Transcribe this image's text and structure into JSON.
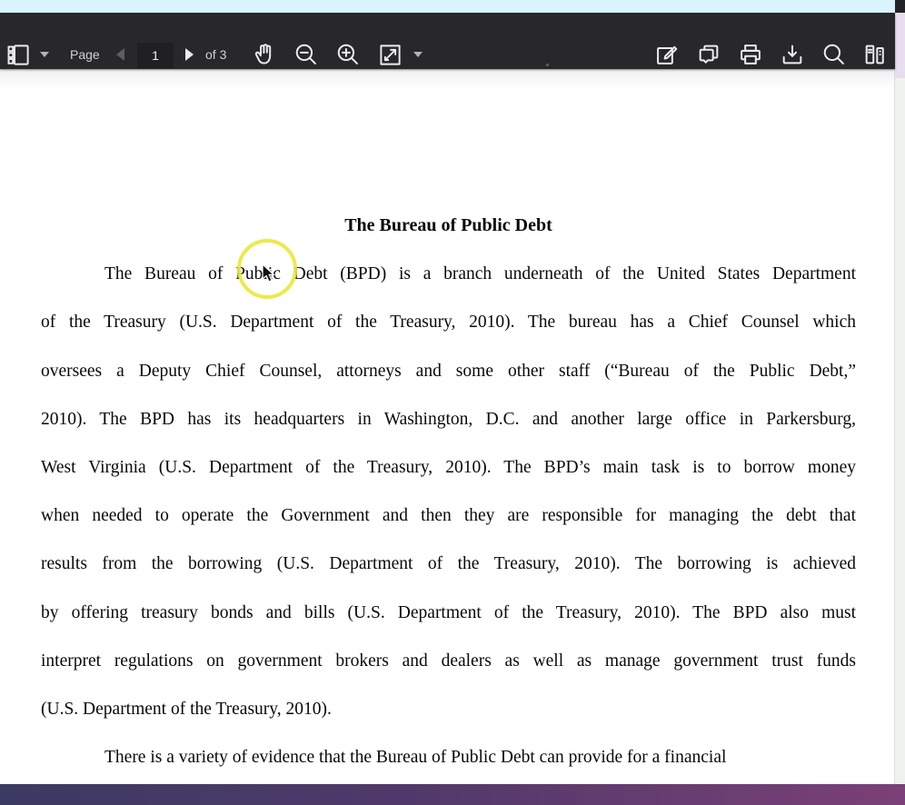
{
  "browser": {
    "top_strip_color": "#d9f4fc",
    "bottom_gradient_left": "#3b3a62",
    "bottom_gradient_right": "#7b4077"
  },
  "toolbar": {
    "background_color": "#28282b",
    "page_label": "Page",
    "page_input_value": "1",
    "page_count_label": "of 3",
    "icons": [
      "sidebar-toggle-icon",
      "sidebar-dropdown-caret",
      "previous-page-icon",
      "next-page-icon",
      "hand-tool-icon",
      "zoom-out-icon",
      "zoom-in-icon",
      "fit-page-icon",
      "fit-dropdown-caret",
      "edit-icon",
      "comments-icon",
      "print-icon",
      "download-icon",
      "search-icon",
      "library-icon"
    ]
  },
  "document": {
    "title": "The Bureau of Public Debt",
    "lines": [
      {
        "type": "title",
        "text": "The Bureau of Public Debt"
      },
      {
        "type": "body",
        "indent": true,
        "justify": true,
        "text": "The Bureau of Public Debt (BPD) is a branch underneath of the United States Department"
      },
      {
        "type": "body",
        "justify": true,
        "text": "of the Treasury (U.S. Department of the Treasury, 2010).  The bureau has a Chief Counsel which"
      },
      {
        "type": "body",
        "justify": true,
        "text": "oversees a Deputy Chief Counsel, attorneys and some other staff (“Bureau of the Public Debt,”"
      },
      {
        "type": "body",
        "justify": true,
        "text": "2010).  The BPD has its headquarters in Washington, D.C. and another large office in Parkersburg,"
      },
      {
        "type": "body",
        "justify": true,
        "text": "West Virginia (U.S. Department of the Treasury, 2010).  The BPD’s main task is to borrow money"
      },
      {
        "type": "body",
        "justify": true,
        "text": "when needed to operate the Government and then they are responsible for managing the debt that"
      },
      {
        "type": "body",
        "justify": true,
        "text": "results from the borrowing (U.S. Department of the Treasury, 2010).  The borrowing is achieved"
      },
      {
        "type": "body",
        "justify": true,
        "text": "by offering treasury bonds and bills (U.S. Department of the Treasury, 2010).  The BPD also must"
      },
      {
        "type": "body",
        "justify": true,
        "text": "interpret regulations on government brokers and dealers as well as manage government trust funds"
      },
      {
        "type": "body",
        "text": "(U.S. Department of the Treasury, 2010)."
      },
      {
        "type": "body",
        "indent": true,
        "text": "There is a variety of evidence that the Bureau of Public Debt can provide for a financial"
      }
    ]
  },
  "highlight": {
    "click_ring_color": "#ece73e"
  }
}
